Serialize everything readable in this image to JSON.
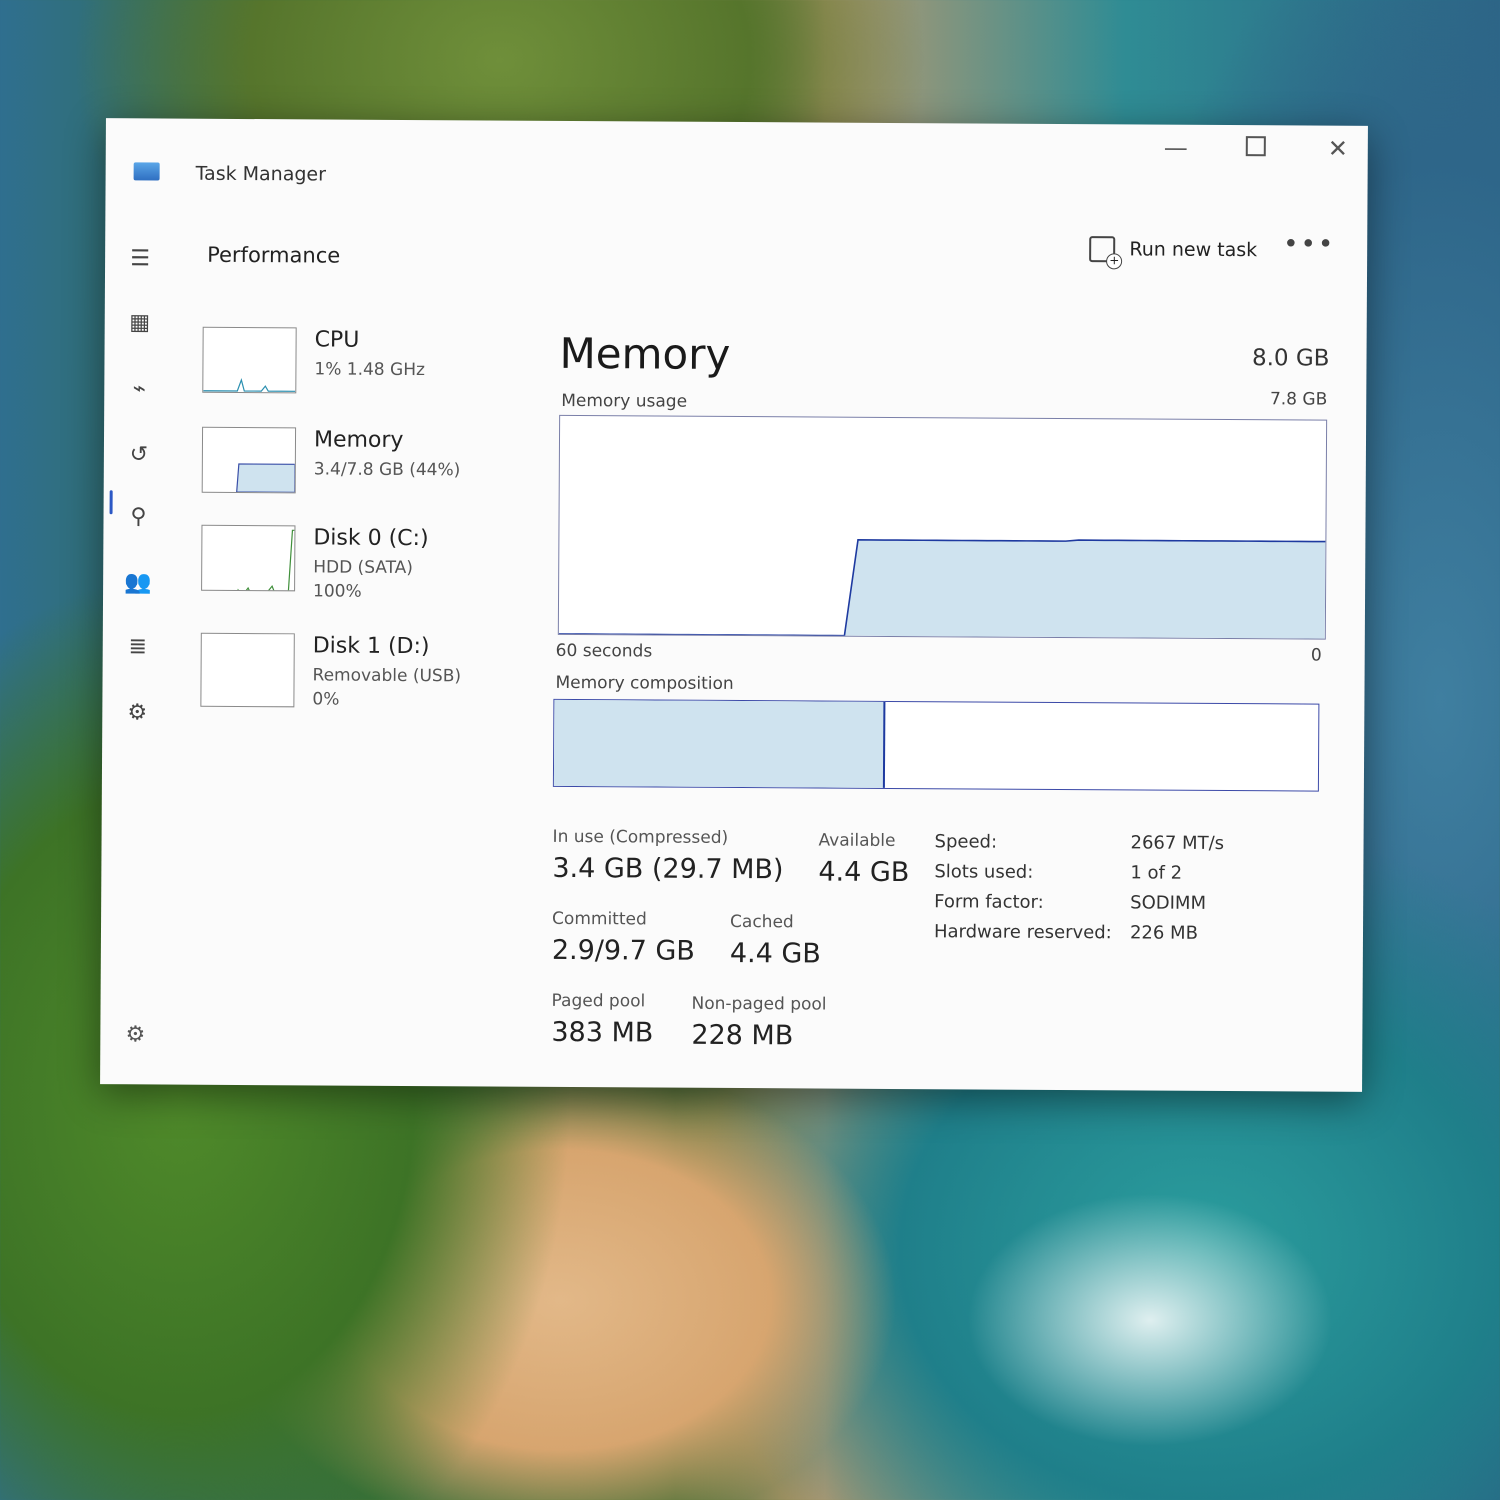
{
  "window": {
    "title": "Task Manager",
    "minimize_icon": "minimize-icon",
    "maximize_icon": "maximize-icon",
    "close_icon": "close-icon"
  },
  "nav": [
    {
      "id": "menu",
      "icon": "hamburger-icon",
      "glyph": "☰"
    },
    {
      "id": "processes",
      "icon": "processes-icon",
      "glyph": "▦"
    },
    {
      "id": "performance",
      "icon": "performance-icon",
      "glyph": "⌁",
      "active": true
    },
    {
      "id": "app-history",
      "icon": "history-icon",
      "glyph": "↺"
    },
    {
      "id": "startup",
      "icon": "startup-icon",
      "glyph": "⚲"
    },
    {
      "id": "users",
      "icon": "users-icon",
      "glyph": "👥"
    },
    {
      "id": "details",
      "icon": "details-icon",
      "glyph": "≣"
    },
    {
      "id": "services",
      "icon": "services-icon",
      "glyph": "⚙"
    }
  ],
  "header": {
    "page_title": "Performance",
    "run_new_task": "Run new task",
    "more": "•••"
  },
  "devices": [
    {
      "name": "CPU",
      "sub1": "1% 1.48 GHz",
      "sub2": "",
      "sub3": ""
    },
    {
      "name": "Memory",
      "sub1": "3.4/7.8 GB (44%)",
      "sub2": "",
      "sub3": ""
    },
    {
      "name": "Disk 0 (C:)",
      "sub1": "HDD (SATA)",
      "sub2": "100%",
      "sub3": ""
    },
    {
      "name": "Disk 1 (D:)",
      "sub1": "Removable (USB)",
      "sub2": "0%",
      "sub3": ""
    }
  ],
  "main": {
    "title": "Memory",
    "total": "8.0 GB",
    "usage_label": "Memory usage",
    "usage_max": "7.8 GB",
    "axis_left": "60 seconds",
    "axis_right": "0",
    "composition_label": "Memory composition",
    "composition_used_fraction": 0.43
  },
  "stats": {
    "in_use_label": "In use (Compressed)",
    "in_use_value": "3.4 GB (29.7 MB)",
    "available_label": "Available",
    "available_value": "4.4 GB",
    "committed_label": "Committed",
    "committed_value": "2.9/9.7 GB",
    "cached_label": "Cached",
    "cached_value": "4.4 GB",
    "paged_label": "Paged pool",
    "paged_value": "383 MB",
    "nonpaged_label": "Non-paged pool",
    "nonpaged_value": "228 MB"
  },
  "specs": [
    {
      "label": "Speed:",
      "value": "2667 MT/s"
    },
    {
      "label": "Slots used:",
      "value": "1 of 2"
    },
    {
      "label": "Form factor:",
      "value": "SODIMM"
    },
    {
      "label": "Hardware reserved:",
      "value": "226 MB"
    }
  ],
  "memory_history": {
    "fraction_of_max": [
      0,
      0,
      0,
      0,
      0,
      0,
      0,
      0,
      0,
      0,
      0,
      0,
      0,
      0,
      0,
      0,
      0,
      0,
      0,
      0,
      0,
      0,
      0,
      0.44,
      0.44,
      0.44,
      0.44,
      0.44,
      0.44,
      0.44,
      0.44,
      0.44,
      0.44,
      0.44,
      0.44,
      0.44,
      0.44,
      0.44,
      0.44,
      0.44,
      0.445,
      0.445,
      0.445,
      0.445,
      0.445,
      0.445,
      0.445,
      0.445,
      0.445,
      0.445,
      0.445,
      0.445,
      0.445,
      0.445,
      0.445,
      0.445,
      0.445,
      0.445,
      0.445,
      0.445
    ]
  },
  "colors": {
    "graph_fill": "#cfe3ef",
    "graph_line": "#1e3aa0",
    "accent": "#2c58c5"
  }
}
